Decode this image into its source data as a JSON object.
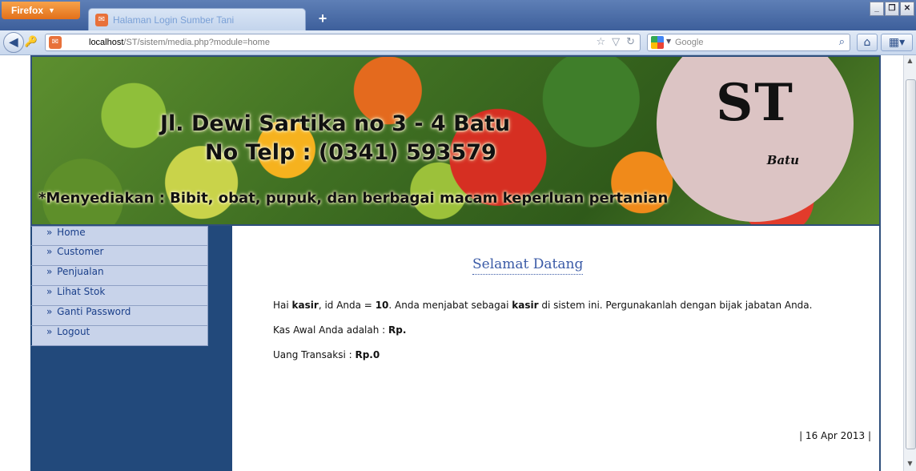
{
  "browser": {
    "app_button": "Firefox",
    "tab_title": "Halaman Login Sumber Tani",
    "new_tab": "+",
    "url_host": "localhost",
    "url_path": "/ST/sistem/media.php?module=home",
    "search_placeholder": "Google"
  },
  "banner": {
    "address": "Jl. Dewi Sartika no 3 - 4 Batu",
    "phone": "No Telp : (0341) 593579",
    "tagline": "*Menyediakan : Bibit, obat, pupuk, dan berbagai macam keperluan pertanian",
    "logo": "ST",
    "logo_sub": "Batu"
  },
  "menu": {
    "bullet": "»",
    "items": [
      {
        "label": "Home"
      },
      {
        "label": "Customer"
      },
      {
        "label": "Penjualan"
      },
      {
        "label": "Lihat Stok"
      },
      {
        "label": "Ganti Password"
      },
      {
        "label": "Logout"
      }
    ]
  },
  "content": {
    "title": "Selamat Datang",
    "greeting_prefix": "Hai",
    "user_role": "kasir",
    "id_label": ", id Anda =",
    "user_id": "10",
    "role_text": ". Anda menjabat sebagai",
    "role_again": "kasir",
    "role_suffix": "di sistem ini. Pergunakanlah dengan bijak jabatan Anda.",
    "kas_label": "Kas Awal Anda adalah :",
    "kas_value": "Rp.",
    "uang_label": "Uang Transaksi :",
    "uang_value": "Rp.0",
    "date": "| 16 Apr 2013 |"
  }
}
